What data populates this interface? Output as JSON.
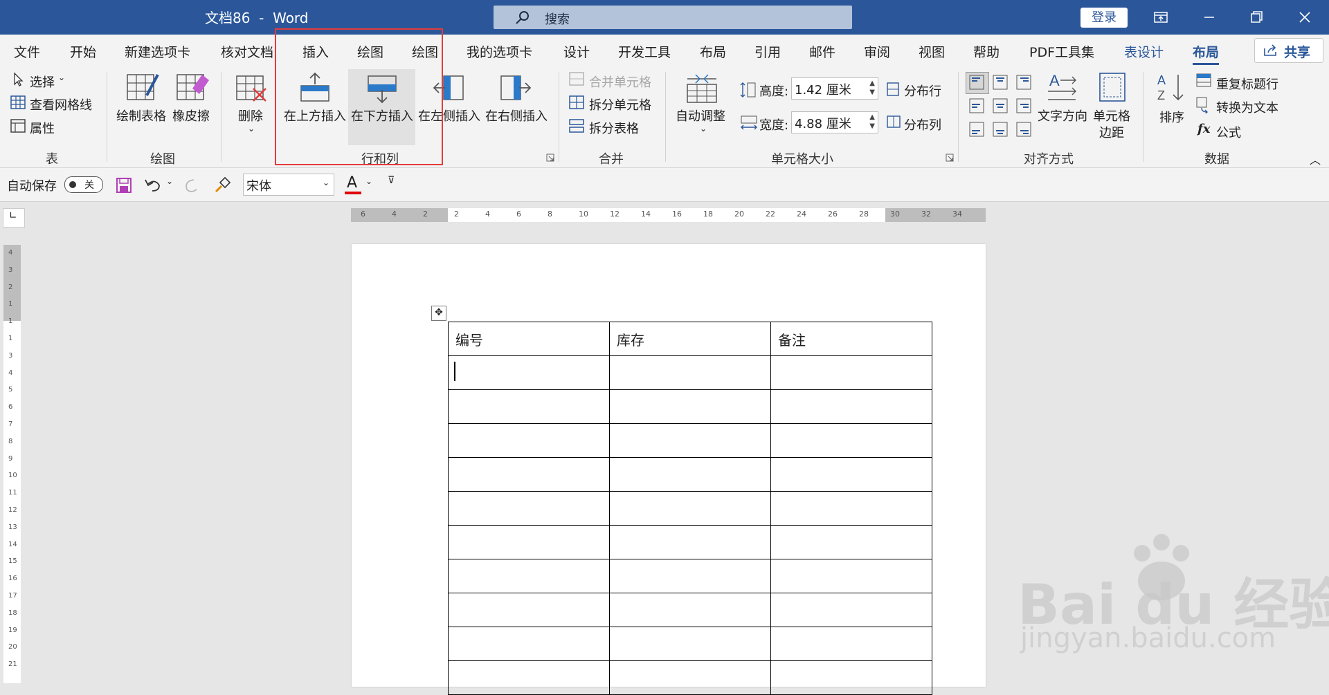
{
  "title_bar": {
    "doc_name": "文档86  -  Word",
    "search_placeholder": "搜索",
    "login_label": "登录"
  },
  "tabs": [
    "文件",
    "开始",
    "新建选项卡",
    "核对文档",
    "插入",
    "绘图",
    "绘图",
    "我的选项卡",
    "设计",
    "开发工具",
    "布局",
    "引用",
    "邮件",
    "审阅",
    "视图",
    "帮助",
    "PDF工具集",
    "表设计",
    "布局"
  ],
  "share_label": "共享",
  "ribbon": {
    "table_group": {
      "select": "选择",
      "gridlines": "查看网格线",
      "properties": "属性",
      "label": "表"
    },
    "draw_group": {
      "draw_table": "绘制表格",
      "eraser": "橡皮擦",
      "label": "绘图"
    },
    "rows_cols_group": {
      "delete": "删除",
      "insert_above": "在上方插入",
      "insert_below": "在下方插入",
      "insert_left": "在左侧插入",
      "insert_right": "在右侧插入",
      "label": "行和列"
    },
    "merge_group": {
      "merge_cells": "合并单元格",
      "split_cells": "拆分单元格",
      "split_table": "拆分表格",
      "label": "合并"
    },
    "cell_size_group": {
      "autofit": "自动调整",
      "height_label": "高度:",
      "height_value": "1.42 厘米",
      "width_label": "宽度:",
      "width_value": "4.88 厘米",
      "distribute_rows": "分布行",
      "distribute_cols": "分布列",
      "label": "单元格大小"
    },
    "alignment_group": {
      "text_direction": "文字方向",
      "cell_margins_1": "单元格",
      "cell_margins_2": "边距",
      "label": "对齐方式"
    },
    "data_group": {
      "sort": "排序",
      "repeat_header": "重复标题行",
      "convert_text": "转换为文本",
      "formula": "公式",
      "label": "数据"
    }
  },
  "qat": {
    "autosave_label": "自动保存",
    "toggle_state": "关",
    "font_name": "宋体"
  },
  "hruler_labels": [
    "6",
    "4",
    "2",
    "2",
    "4",
    "6",
    "8",
    "10",
    "12",
    "14",
    "16",
    "18",
    "20",
    "22",
    "24",
    "26",
    "28",
    "30",
    "32",
    "34"
  ],
  "vruler_labels": [
    "4",
    "3",
    "2",
    "1",
    "1",
    "1",
    "3",
    "4",
    "5",
    "6",
    "7",
    "8",
    "9",
    "10",
    "11",
    "12",
    "13",
    "14",
    "15",
    "16",
    "17",
    "18",
    "19",
    "20",
    "21"
  ],
  "table": {
    "headers": [
      "编号",
      "库存",
      "备注"
    ],
    "empty_rows": 10
  },
  "watermark": {
    "brand": "Bai du 经验",
    "url": "jingyan.baidu.com"
  },
  "colors": {
    "brand": "#2b579a",
    "highlight": "#e33b3b",
    "font_color_bar": "#e00000"
  }
}
